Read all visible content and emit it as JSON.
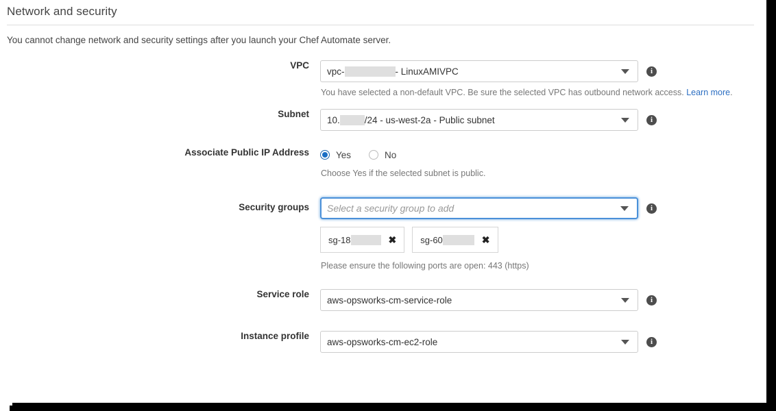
{
  "page": {
    "title": "Network and security",
    "intro": "You cannot change network and security settings after you launch your Chef Automate server."
  },
  "fields": {
    "vpc": {
      "label": "VPC",
      "value_prefix": "vpc-",
      "value_suffix": " - LinuxAMIVPC",
      "redacted": true,
      "caret": "chevron-down-icon",
      "info": "i",
      "hint_text": "You have selected a non-default VPC. Be sure the selected VPC has outbound network access. ",
      "hint_link": "Learn more",
      "hint_link_suffix": "."
    },
    "subnet": {
      "label": "Subnet",
      "value_prefix": "10.",
      "value_suffix": "/24 - us-west-2a - Public subnet",
      "redacted": true,
      "caret": "chevron-down-icon",
      "info": "i"
    },
    "associate_public_ip": {
      "label": "Associate Public IP Address",
      "options": [
        {
          "label": "Yes",
          "selected": true
        },
        {
          "label": "No",
          "selected": false
        }
      ],
      "hint_text": "Choose Yes if the selected subnet is public."
    },
    "security_groups": {
      "label": "Security groups",
      "placeholder": "Select a security group to add",
      "value": "",
      "focused": true,
      "caret": "chevron-down-icon",
      "info": "i",
      "chips": [
        {
          "label": "sg-18",
          "redacted": true,
          "remove": "✖"
        },
        {
          "label": "sg-60",
          "redacted": true,
          "remove": "✖"
        }
      ],
      "hint_text": "Please ensure the following ports are open: 443 (https)"
    },
    "service_role": {
      "label": "Service role",
      "value": "aws-opsworks-cm-service-role",
      "caret": "chevron-down-icon",
      "info": "i"
    },
    "instance_profile": {
      "label": "Instance profile",
      "value": "aws-opsworks-cm-ec2-role",
      "caret": "chevron-down-icon",
      "info": "i"
    }
  },
  "colors": {
    "accent_blue": "#1a6fc4",
    "link_blue": "#2b6ec2",
    "focus_blue": "#4a90d9",
    "border_gray": "#cccccc",
    "redaction_gray": "#dfdfdf",
    "text": "#333333",
    "hint_text": "#777777"
  }
}
